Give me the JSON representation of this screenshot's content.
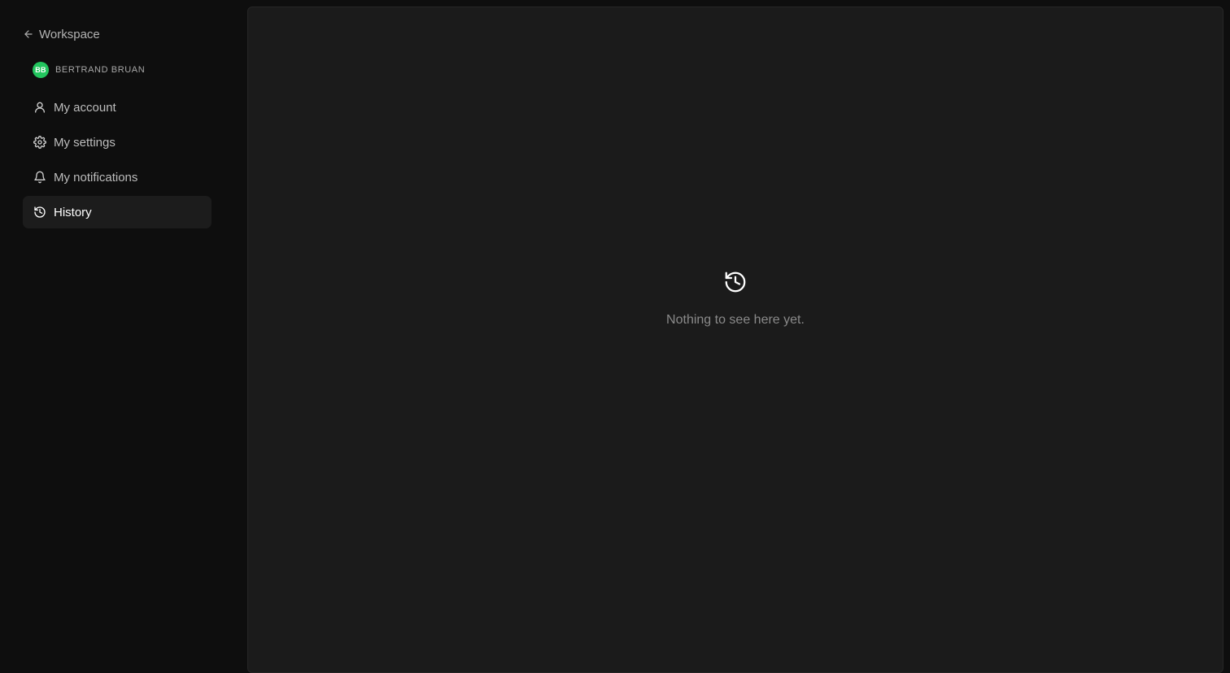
{
  "sidebar": {
    "back": {
      "label": "Workspace",
      "icon": "arrow-left-icon"
    },
    "user": {
      "initials": "BB",
      "name": "BERTRAND BRUAN",
      "avatar_color": "#22c55e"
    },
    "items": [
      {
        "label": "My account",
        "icon": "user-icon",
        "active": false
      },
      {
        "label": "My settings",
        "icon": "gear-icon",
        "active": false
      },
      {
        "label": "My notifications",
        "icon": "bell-icon",
        "active": false
      },
      {
        "label": "History",
        "icon": "history-icon",
        "active": true
      }
    ]
  },
  "main": {
    "empty_state": {
      "icon": "history-icon",
      "message": "Nothing to see here yet."
    }
  },
  "colors": {
    "background": "#0e0e0e",
    "panel": "#1b1b1b",
    "active_item": "#1c1c1c",
    "accent": "#22c55e"
  }
}
